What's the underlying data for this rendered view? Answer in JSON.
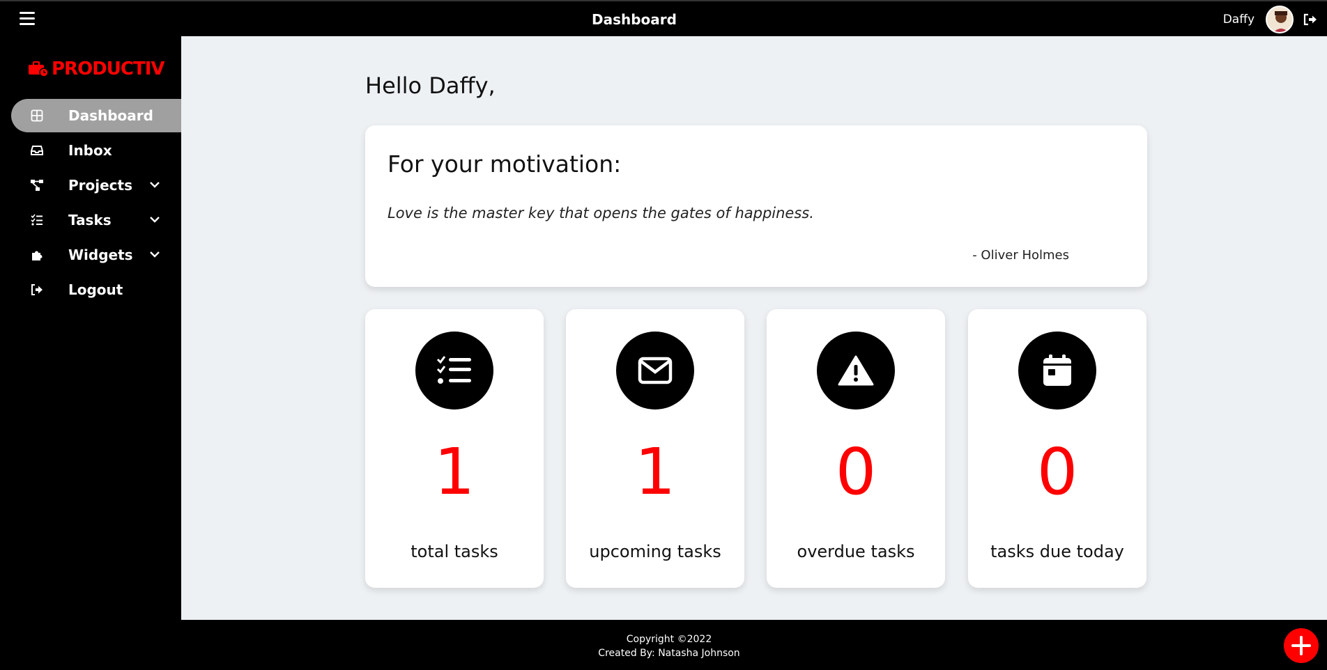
{
  "header": {
    "title": "Dashboard",
    "username": "Daffy"
  },
  "sidebar": {
    "logo": "PRODUCTIV",
    "items": [
      {
        "label": "Dashboard",
        "icon": "grid-icon",
        "active": true
      },
      {
        "label": "Inbox",
        "icon": "inbox-icon"
      },
      {
        "label": "Projects",
        "icon": "project-diagram-icon",
        "expandable": true
      },
      {
        "label": "Tasks",
        "icon": "tasks-icon",
        "expandable": true
      },
      {
        "label": "Widgets",
        "icon": "puzzle-icon",
        "expandable": true
      },
      {
        "label": "Logout",
        "icon": "logout-icon"
      }
    ]
  },
  "main": {
    "greeting": "Hello Daffy,",
    "motivation": {
      "title": "For your motivation:",
      "quote": "Love is the master key that opens the gates of happiness.",
      "author": "- Oliver Holmes"
    },
    "stats": [
      {
        "value": "1",
        "label": "total tasks",
        "icon": "tasks-list-icon"
      },
      {
        "value": "1",
        "label": "upcoming tasks",
        "icon": "envelope-icon"
      },
      {
        "value": "0",
        "label": "overdue tasks",
        "icon": "warning-icon"
      },
      {
        "value": "0",
        "label": "tasks due today",
        "icon": "calendar-icon"
      }
    ]
  },
  "footer": {
    "copyright": "Copyright ©2022",
    "credit": "Created By: Natasha Johnson"
  },
  "colors": {
    "accent": "#ff0000",
    "background": "#eef1f4",
    "dark": "#000000"
  }
}
